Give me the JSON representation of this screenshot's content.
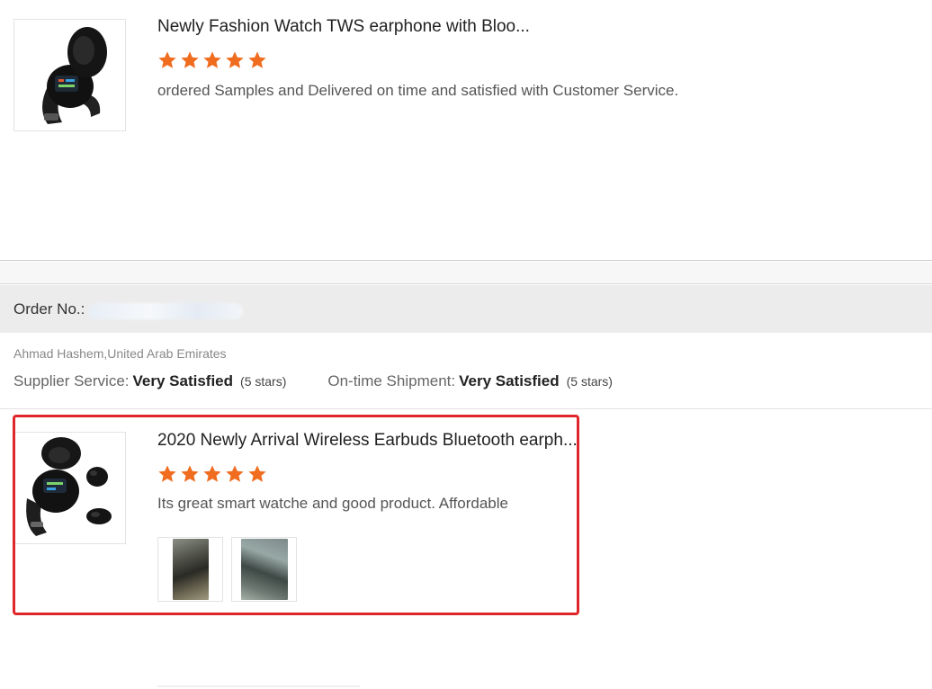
{
  "reviews": [
    {
      "product_title": "Newly Fashion Watch TWS earphone with Bloo...",
      "rating": 5,
      "comment": "ordered Samples and Delivered on time and satisfied with Customer Service."
    },
    {
      "product_title": "2020 Newly Arrival Wireless Earbuds Bluetooth earph...",
      "rating": 5,
      "comment": "Its  great smart watche and good product. Affordable"
    }
  ],
  "order": {
    "label": "Order No.:"
  },
  "buyer": "Ahmad Hashem,United Arab Emirates",
  "ratings": {
    "supplier_label": "Supplier Service:",
    "supplier_value": "Very Satisfied",
    "supplier_stars": "(5 stars)",
    "shipment_label": "On-time Shipment:",
    "shipment_value": "Very Satisfied",
    "shipment_stars": "(5 stars)"
  },
  "colors": {
    "star": "#f06c1e",
    "highlight": "#e0262b"
  },
  "icons": {
    "star": "star-icon"
  }
}
